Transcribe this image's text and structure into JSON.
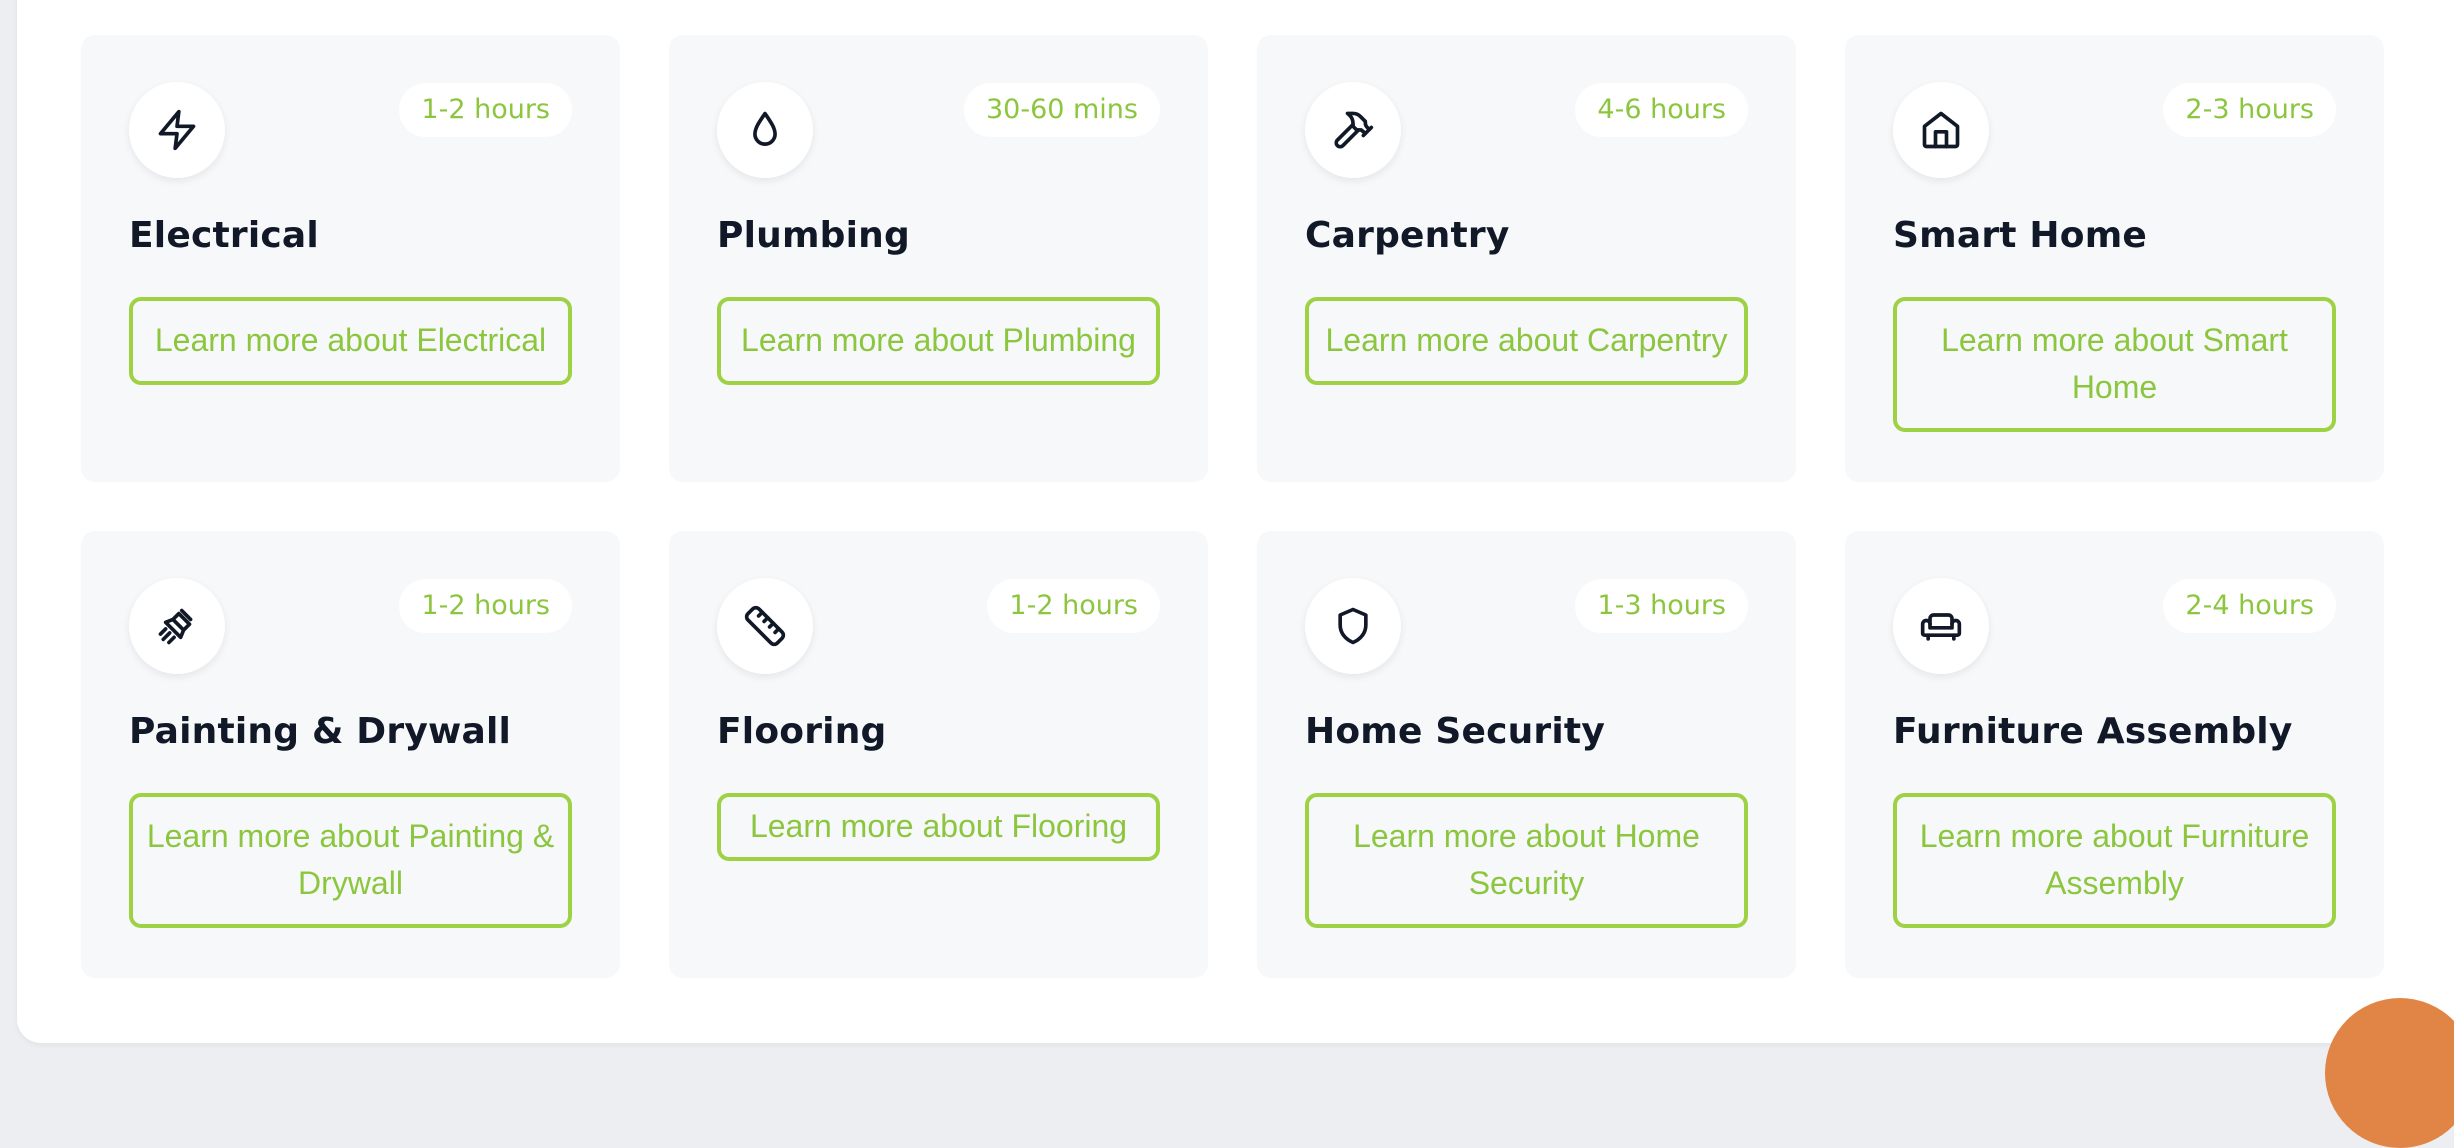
{
  "colors": {
    "accent": "#8cc63f",
    "button_border": "#9ed144",
    "title": "#111827",
    "card_bg": "#f7f8fa",
    "fab": "#e08546"
  },
  "services": [
    {
      "title": "Electrical",
      "duration": "1-2 hours",
      "cta": "Learn more about Electrical",
      "icon": "lightning-icon"
    },
    {
      "title": "Plumbing",
      "duration": "30-60 mins",
      "cta": "Learn more about Plumbing",
      "icon": "droplet-icon"
    },
    {
      "title": "Carpentry",
      "duration": "4-6 hours",
      "cta": "Learn more about Carpentry",
      "icon": "hammer-icon"
    },
    {
      "title": "Smart Home",
      "duration": "2-3 hours",
      "cta": "Learn more about Smart Home",
      "icon": "home-icon"
    },
    {
      "title": "Painting & Drywall",
      "duration": "1-2 hours",
      "cta": "Learn more about Painting & Drywall",
      "icon": "paintbrush-icon"
    },
    {
      "title": "Flooring",
      "duration": "1-2 hours",
      "cta": "Learn more about Flooring",
      "icon": "ruler-icon"
    },
    {
      "title": "Home Security",
      "duration": "1-3 hours",
      "cta": "Learn more about Home Security",
      "icon": "shield-icon"
    },
    {
      "title": "Furniture Assembly",
      "duration": "2-4 hours",
      "cta": "Learn more about Furniture Assembly",
      "icon": "sofa-icon"
    }
  ]
}
